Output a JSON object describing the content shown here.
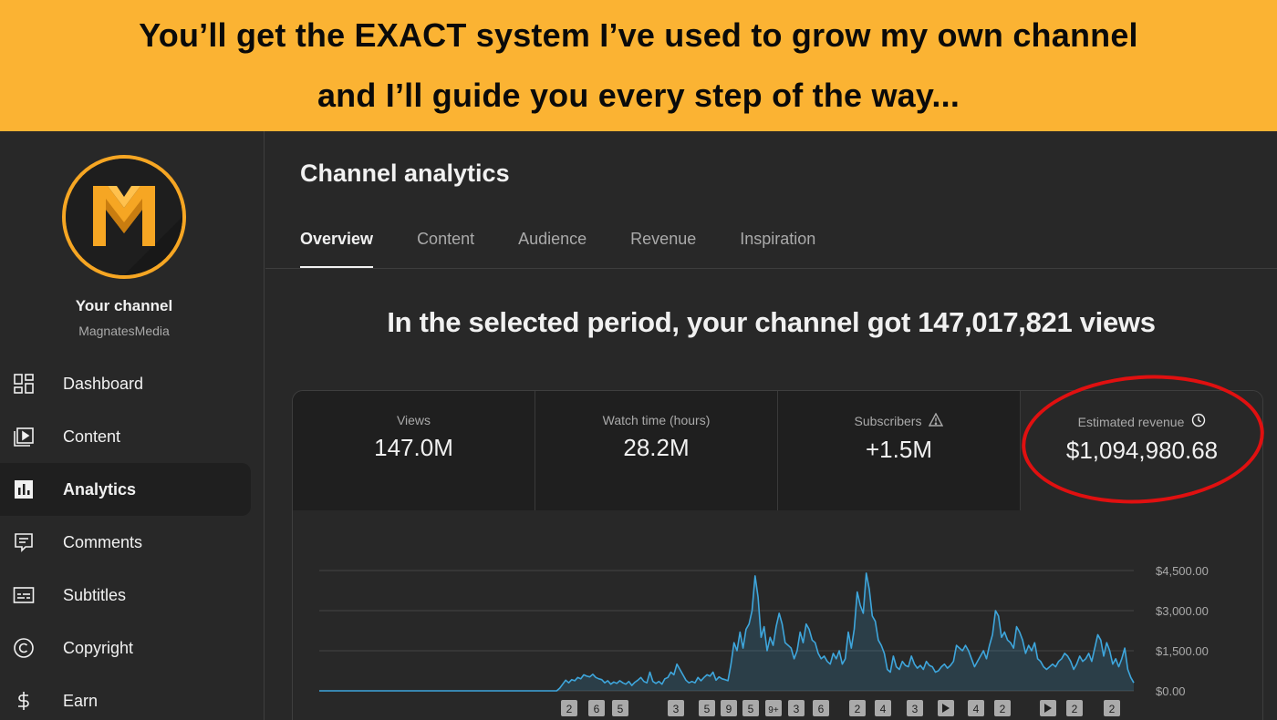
{
  "banner": {
    "line1": "You’ll get the EXACT system I’ve used to grow my own channel",
    "line2": "and I’ll guide you every step of the way...",
    "background": "#fbb333"
  },
  "sidebar": {
    "channel_label": "Your channel",
    "channel_handle": "MagnatesMedia",
    "items": [
      {
        "label": "Dashboard",
        "icon": "dashboard-icon"
      },
      {
        "label": "Content",
        "icon": "content-icon"
      },
      {
        "label": "Analytics",
        "icon": "analytics-icon",
        "active": true
      },
      {
        "label": "Comments",
        "icon": "comments-icon"
      },
      {
        "label": "Subtitles",
        "icon": "subtitles-icon"
      },
      {
        "label": "Copyright",
        "icon": "copyright-icon"
      },
      {
        "label": "Earn",
        "icon": "earn-icon"
      }
    ]
  },
  "main": {
    "title": "Channel analytics",
    "tabs": [
      "Overview",
      "Content",
      "Audience",
      "Revenue",
      "Inspiration"
    ],
    "headline": "In the selected period, your channel got 147,017,821 views",
    "metrics": [
      {
        "label": "Views",
        "value": "147.0M"
      },
      {
        "label": "Watch time (hours)",
        "value": "28.2M"
      },
      {
        "label": "Subscribers",
        "value": "+1.5M",
        "icon": "warning-icon"
      },
      {
        "label": "Estimated revenue",
        "value": "$1,094,980.68",
        "icon": "clock-icon"
      }
    ]
  },
  "chart_data": {
    "type": "area",
    "title": "",
    "ylabel": "",
    "y_ticks": [
      "$4,500.00",
      "$3,000.00",
      "$1,500.00",
      "$0.00"
    ],
    "ylim": [
      0,
      4500
    ],
    "grid": true,
    "series": [
      {
        "values": [
          0,
          0,
          0,
          0,
          0,
          0,
          0,
          0,
          0,
          0,
          0,
          0,
          0,
          0,
          0,
          0,
          0,
          0,
          0,
          0,
          0,
          0,
          0,
          0,
          0,
          0,
          0,
          0,
          0,
          0,
          0,
          0,
          0,
          0,
          0,
          0,
          0,
          0,
          0,
          0,
          0,
          0,
          0,
          0,
          0,
          0,
          0,
          0,
          0,
          0,
          0,
          0,
          0,
          0,
          0,
          0,
          0,
          0,
          0,
          0,
          0,
          0,
          0,
          0,
          0,
          0,
          0,
          0,
          0,
          0,
          0,
          0,
          0,
          0,
          0,
          0,
          0,
          0,
          0,
          0,
          100,
          250,
          400,
          300,
          420,
          380,
          500,
          450,
          600,
          550,
          520,
          620,
          500,
          450,
          420,
          300,
          380,
          250,
          330,
          280,
          380,
          300,
          250,
          350,
          200,
          320,
          400,
          500,
          350,
          300,
          700,
          350,
          280,
          350,
          250,
          450,
          500,
          700,
          600,
          1000,
          800,
          600,
          400,
          300,
          350,
          300,
          500,
          380,
          500,
          600,
          550,
          700,
          400,
          520,
          450,
          420,
          380,
          1000,
          1800,
          1500,
          2200,
          1600,
          2300,
          2500,
          3000,
          4300,
          3500,
          2000,
          2400,
          1500,
          2000,
          1700,
          2400,
          2900,
          2500,
          1800,
          1700,
          1600,
          1200,
          1500,
          2200,
          1800,
          2500,
          2300,
          1900,
          1800,
          1400,
          1200,
          1300,
          1100,
          1000,
          1400,
          1200,
          1500,
          1000,
          1200,
          2200,
          1600,
          2300,
          3700,
          3200,
          2900,
          4400,
          3800,
          2800,
          2600,
          1900,
          1700,
          1400,
          800,
          700,
          1300,
          900,
          800,
          1100,
          950,
          900,
          1300,
          1000,
          850,
          950,
          800,
          1100,
          950,
          900,
          700,
          750,
          900,
          1000,
          850,
          950,
          1100,
          1700,
          1600,
          1500,
          1700,
          1500,
          1200,
          900,
          1100,
          1300,
          1500,
          1200,
          1700,
          2100,
          3000,
          2800,
          2000,
          2200,
          1900,
          1800,
          1600,
          2400,
          2200,
          1900,
          1400,
          1700,
          1500,
          1800,
          1200,
          1100,
          900,
          800,
          900,
          1000,
          900,
          1100,
          1200,
          1400,
          1300,
          1100,
          800,
          1000,
          1300,
          1100,
          1200,
          1400,
          1100,
          1600,
          2100,
          1900,
          1300,
          1800,
          1500,
          1000,
          1200,
          900,
          1200,
          1600,
          800,
          500,
          300
        ],
        "color": "#3ea6dc"
      }
    ],
    "annotation_markers": [
      "2",
      "6",
      "5",
      "3",
      "5",
      "9",
      "5",
      "9+",
      "3",
      "6",
      "2",
      "4",
      "3",
      "play",
      "4",
      "2",
      "play",
      "2",
      "2"
    ]
  },
  "colors": {
    "accent": "#3ea6dc",
    "highlight_ring": "#e01010",
    "logo": "#f6a623"
  }
}
